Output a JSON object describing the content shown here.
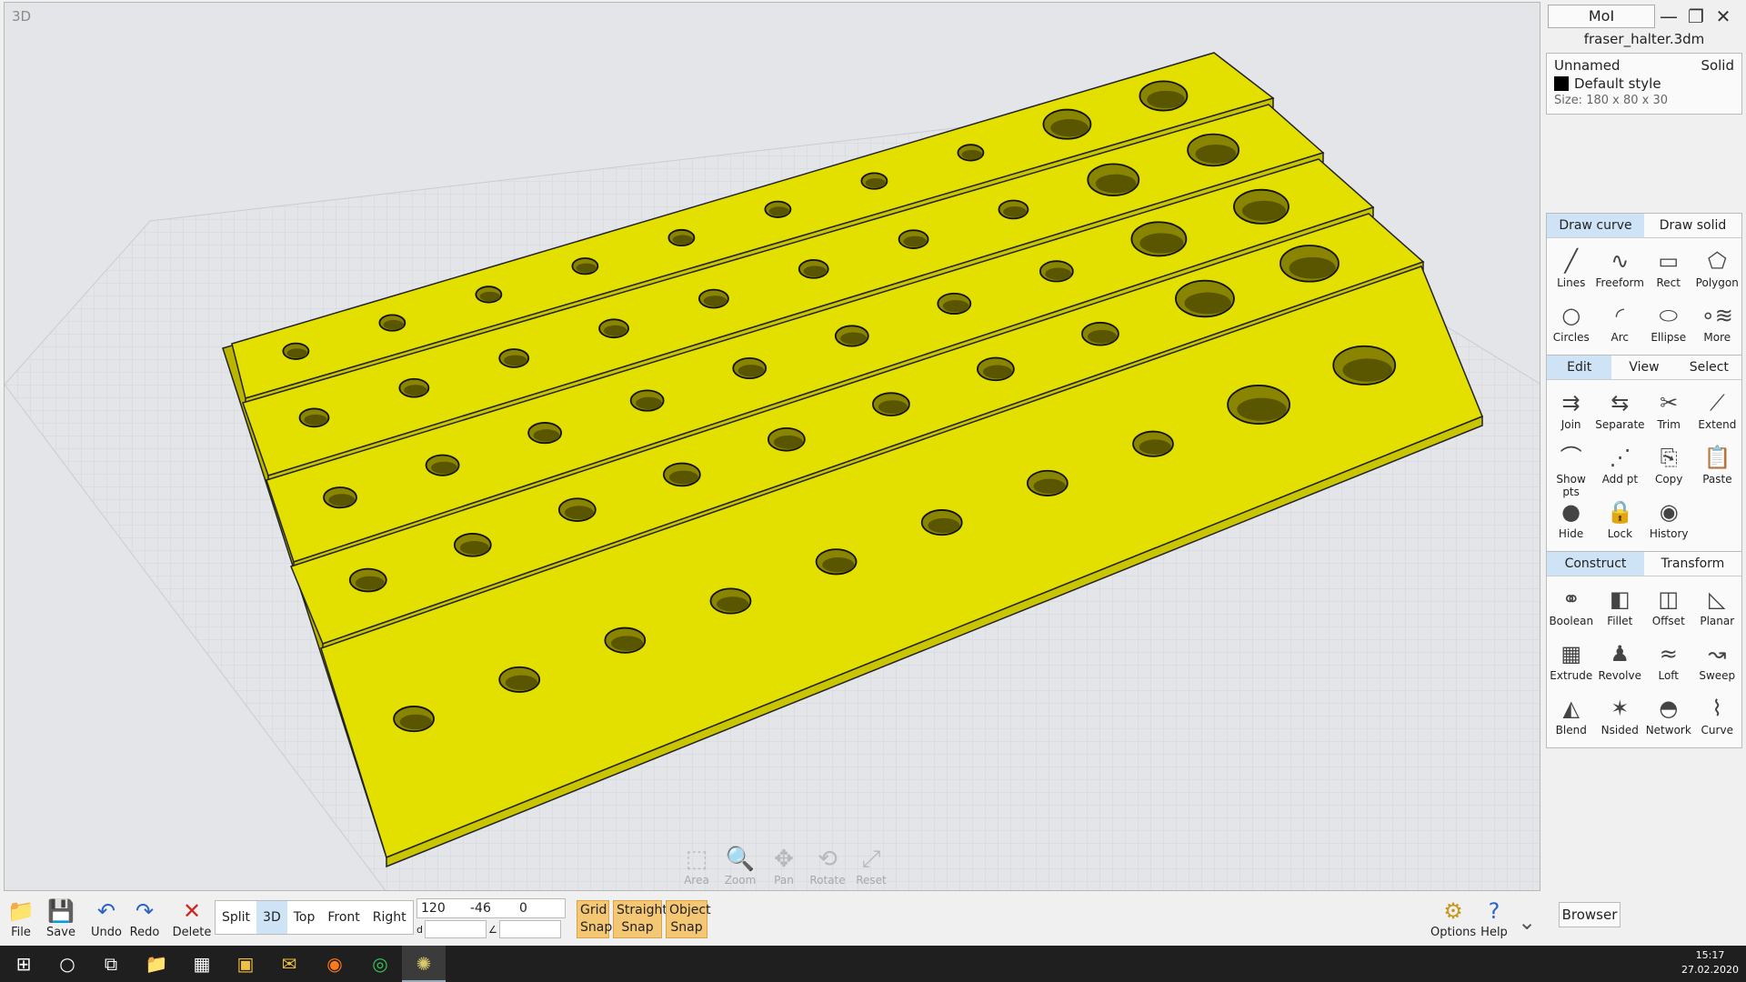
{
  "viewport": {
    "label": "3D"
  },
  "nav_tools": [
    {
      "label": "Area",
      "icon": "area-icon",
      "glyph": "⬚"
    },
    {
      "label": "Zoom",
      "icon": "zoom-icon",
      "glyph": "🔍"
    },
    {
      "label": "Pan",
      "icon": "pan-icon",
      "glyph": "✥"
    },
    {
      "label": "Rotate",
      "icon": "rotate-icon",
      "glyph": "⟲"
    },
    {
      "label": "Reset",
      "icon": "reset-icon",
      "glyph": "⤢"
    }
  ],
  "window": {
    "app_name": "MoI",
    "filename": "fraser_halter.3dm"
  },
  "properties": {
    "name": "Unnamed",
    "type": "Solid",
    "style": "Default style",
    "size": "Size: 180 x 80 x 30"
  },
  "draw_tabs": [
    "Draw curve",
    "Draw solid"
  ],
  "draw_commands": [
    {
      "label": "Lines",
      "glyph": "╱"
    },
    {
      "label": "Freeform",
      "glyph": "∿"
    },
    {
      "label": "Rect",
      "glyph": "▭"
    },
    {
      "label": "Polygon",
      "glyph": "⬠"
    },
    {
      "label": "Circles",
      "glyph": "○"
    },
    {
      "label": "Arc",
      "glyph": "◜"
    },
    {
      "label": "Ellipse",
      "glyph": "⬭"
    },
    {
      "label": "More",
      "glyph": "∘≋"
    }
  ],
  "edit_tabs": [
    "Edit",
    "View",
    "Select"
  ],
  "edit_commands": [
    {
      "label": "Join",
      "glyph": "⇉"
    },
    {
      "label": "Separate",
      "glyph": "⇆"
    },
    {
      "label": "Trim",
      "glyph": "✂"
    },
    {
      "label": "Extend",
      "glyph": "⟋"
    },
    {
      "label": "Show pts",
      "glyph": "⌒"
    },
    {
      "label": "Add pt",
      "glyph": "⋰"
    },
    {
      "label": "Copy",
      "glyph": "⎘"
    },
    {
      "label": "Paste",
      "glyph": "📋"
    },
    {
      "label": "Hide",
      "glyph": "●"
    },
    {
      "label": "Lock",
      "glyph": "🔒"
    },
    {
      "label": "History",
      "glyph": "◉"
    }
  ],
  "construct_tabs": [
    "Construct",
    "Transform"
  ],
  "construct_commands": [
    {
      "label": "Boolean",
      "glyph": "⚭"
    },
    {
      "label": "Fillet",
      "glyph": "◧"
    },
    {
      "label": "Offset",
      "glyph": "◫"
    },
    {
      "label": "Planar",
      "glyph": "◺"
    },
    {
      "label": "Extrude",
      "glyph": "▦"
    },
    {
      "label": "Revolve",
      "glyph": "♟"
    },
    {
      "label": "Loft",
      "glyph": "≈"
    },
    {
      "label": "Sweep",
      "glyph": "↝"
    },
    {
      "label": "Blend",
      "glyph": "◭"
    },
    {
      "label": "Nsided",
      "glyph": "✶"
    },
    {
      "label": "Network",
      "glyph": "◓"
    },
    {
      "label": "Curve",
      "glyph": "⌇"
    }
  ],
  "toolbar": {
    "file": "File",
    "save": "Save",
    "undo": "Undo",
    "redo": "Redo",
    "delete": "Delete",
    "views": [
      "Split",
      "3D",
      "Top",
      "Front",
      "Right"
    ],
    "coords": [
      "120",
      "-46",
      "0"
    ],
    "coord_d": "d",
    "coord_angle": "∠",
    "grid_snap": "Grid Snap",
    "straight_snap": "Straight Snap",
    "object_snap": "Object Snap",
    "options": "Options",
    "help": "Help",
    "browser": "Browser"
  },
  "taskbar": {
    "time": "15:17",
    "date": "27.02.2020"
  },
  "colors": {
    "model": "#e3e000",
    "active_tab": "#cfe3f6",
    "snap": "#f4c774"
  }
}
